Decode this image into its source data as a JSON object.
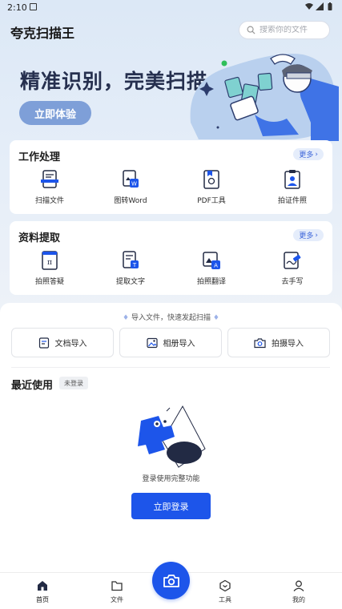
{
  "status_bar": {
    "time": "2:10"
  },
  "header": {
    "app_title": "夸克扫描王",
    "search_placeholder": "搜索你的文件"
  },
  "banner": {
    "headline": "精准识别，完美扫描",
    "cta_label": "立即体验"
  },
  "work_section": {
    "title": "工作处理",
    "more_label": "更多",
    "items": [
      {
        "label": "扫描文件",
        "icon": "scan-file-icon"
      },
      {
        "label": "图转Word",
        "icon": "image-to-word-icon"
      },
      {
        "label": "PDF工具",
        "icon": "pdf-tool-icon"
      },
      {
        "label": "拍证件照",
        "icon": "id-photo-icon"
      }
    ]
  },
  "extract_section": {
    "title": "资料提取",
    "more_label": "更多",
    "items": [
      {
        "label": "拍照答疑",
        "icon": "photo-answer-icon"
      },
      {
        "label": "提取文字",
        "icon": "extract-text-icon"
      },
      {
        "label": "拍照翻译",
        "icon": "photo-translate-icon"
      },
      {
        "label": "去手写",
        "icon": "remove-handwriting-icon"
      }
    ]
  },
  "import": {
    "tip": "导入文件，快速发起扫描",
    "buttons": [
      {
        "label": "文档导入",
        "icon": "document-icon"
      },
      {
        "label": "相册导入",
        "icon": "album-icon"
      },
      {
        "label": "拍摄导入",
        "icon": "camera-icon"
      }
    ]
  },
  "recent": {
    "title": "最近使用",
    "tag": "未登录",
    "empty_text": "登录使用完整功能",
    "login_label": "立即登录"
  },
  "nav": {
    "items": [
      {
        "label": "首页",
        "icon": "home-icon",
        "active": true
      },
      {
        "label": "文件",
        "icon": "folder-icon",
        "active": false
      },
      {
        "label": "工具",
        "icon": "tools-icon",
        "active": false
      },
      {
        "label": "我的",
        "icon": "profile-icon",
        "active": false
      }
    ]
  },
  "colors": {
    "accent": "#1d55ea",
    "banner_button": "#7e9fd8",
    "more_bg": "#e5edfb"
  }
}
